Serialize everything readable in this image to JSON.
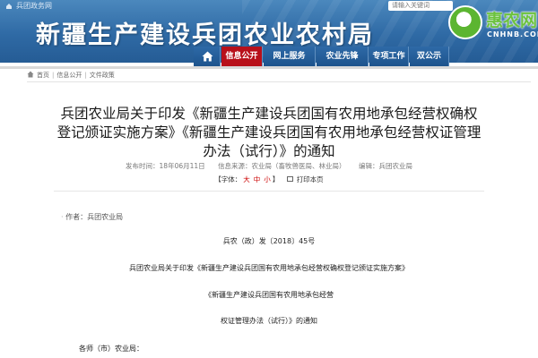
{
  "topbar": {
    "gov_link": "兵团政务网",
    "search_placeholder": "请输入关键词"
  },
  "header": {
    "site_title": "新疆生产建设兵团农业农村局"
  },
  "logo": {
    "text": "惠农网",
    "sub": "CNHNB.COM"
  },
  "nav": {
    "items": [
      {
        "label": "信息公开",
        "active": true
      },
      {
        "label": "网上服务",
        "active": false
      },
      {
        "label": "农业先锋",
        "active": false
      },
      {
        "label": "专项工作",
        "active": false
      },
      {
        "label": "双公示",
        "active": false
      }
    ]
  },
  "breadcrumb": {
    "items": [
      "首页",
      "信息公开",
      "文件政策"
    ]
  },
  "article": {
    "title": "兵团农业局关于印发《新疆生产建设兵团国有农用地承包经营权确权登记颁证实施方案》《新疆生产建设兵团国有农用地承包经营权证管理办法（试行）》的通知",
    "publish_time": "发布时间：18年06月11日",
    "source": "信息来源：农业局（畜牧兽医局、林业局）",
    "editor": "编辑：兵团农业局",
    "font_label": "【字体：",
    "font_large": "大",
    "font_medium": "中",
    "font_small": "小",
    "font_close": "】",
    "print_label": "打印本页",
    "author": "作者：兵团农业局",
    "doc_number": "兵农（政）发〔2018〕45号",
    "body_line2": "兵团农业局关于印发《新疆生产建设兵团国有农用地承包经营权确权登记颁证实施方案》",
    "body_line3": "《新疆生产建设兵团国有农用地承包经营",
    "body_line4": "权证管理办法（试行）》的通知",
    "body_line5": "各师（市）农业局："
  }
}
